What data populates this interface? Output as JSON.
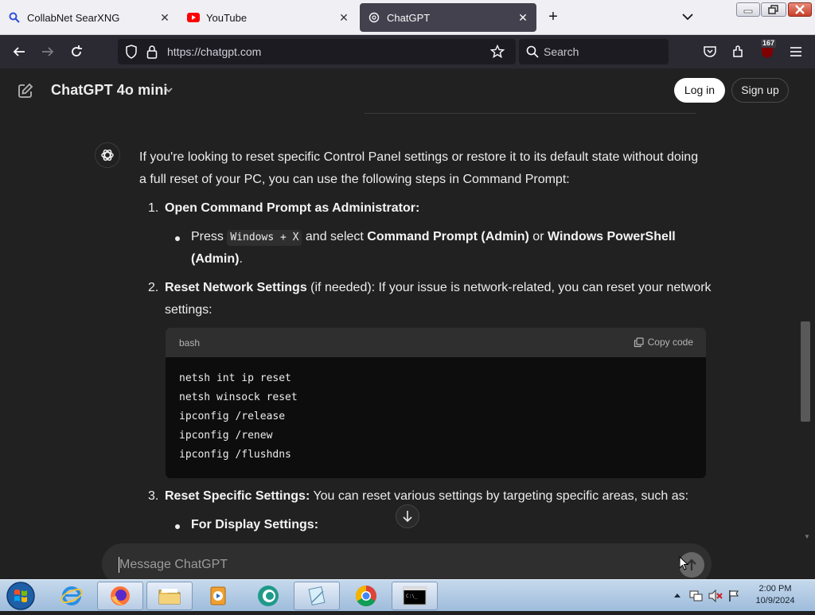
{
  "browser": {
    "tabs": [
      {
        "title": "CollabNet SearXNG",
        "active": false,
        "icon": "search-icon"
      },
      {
        "title": "YouTube",
        "active": false,
        "icon": "youtube-icon"
      },
      {
        "title": "ChatGPT",
        "active": true,
        "icon": "chatgpt-icon"
      }
    ],
    "url": "https://chatgpt.com",
    "search_placeholder": "Search",
    "extension_badge": "167"
  },
  "header": {
    "model": "ChatGPT 4o mini",
    "login_label": "Log in",
    "signup_label": "Sign up"
  },
  "message": {
    "intro_line1": "If you're looking to reset specific Control Panel settings or restore it to its default state without doing",
    "intro_line2": "a full reset of your PC, you can use the following steps in Command Prompt:",
    "steps": [
      {
        "number": "1.",
        "title": "Open Command Prompt as Administrator:",
        "bullet": {
          "press": "Press",
          "key": "Windows + X",
          "and_select": "and select",
          "opt1": "Command Prompt (Admin)",
          "or": "or",
          "opt2_line1": "Windows PowerShell",
          "opt2_line2": "(Admin)",
          "period": "."
        }
      },
      {
        "number": "2.",
        "title": "Reset Network Settings",
        "rest_line1": "(if needed): If your issue is network-related, you can reset your network",
        "rest_line2": "settings:"
      },
      {
        "number": "3.",
        "title": "Reset Specific Settings:",
        "rest": "You can reset various settings by targeting specific areas, such as:",
        "bullet_title": "For Display Settings:"
      }
    ],
    "code": {
      "language": "bash",
      "copy_label": "Copy code",
      "lines": [
        "netsh int ip reset",
        "netsh winsock reset",
        "ipconfig /release",
        "ipconfig /renew",
        "ipconfig /flushdns"
      ]
    }
  },
  "composer": {
    "placeholder": "Message ChatGPT"
  },
  "taskbar": {
    "apps": [
      "internet-explorer",
      "firefox",
      "file-explorer",
      "media-player",
      "browser-app",
      "notes-app",
      "chrome",
      "command-prompt"
    ],
    "time": "2:00 PM",
    "date": "10/9/2024"
  }
}
